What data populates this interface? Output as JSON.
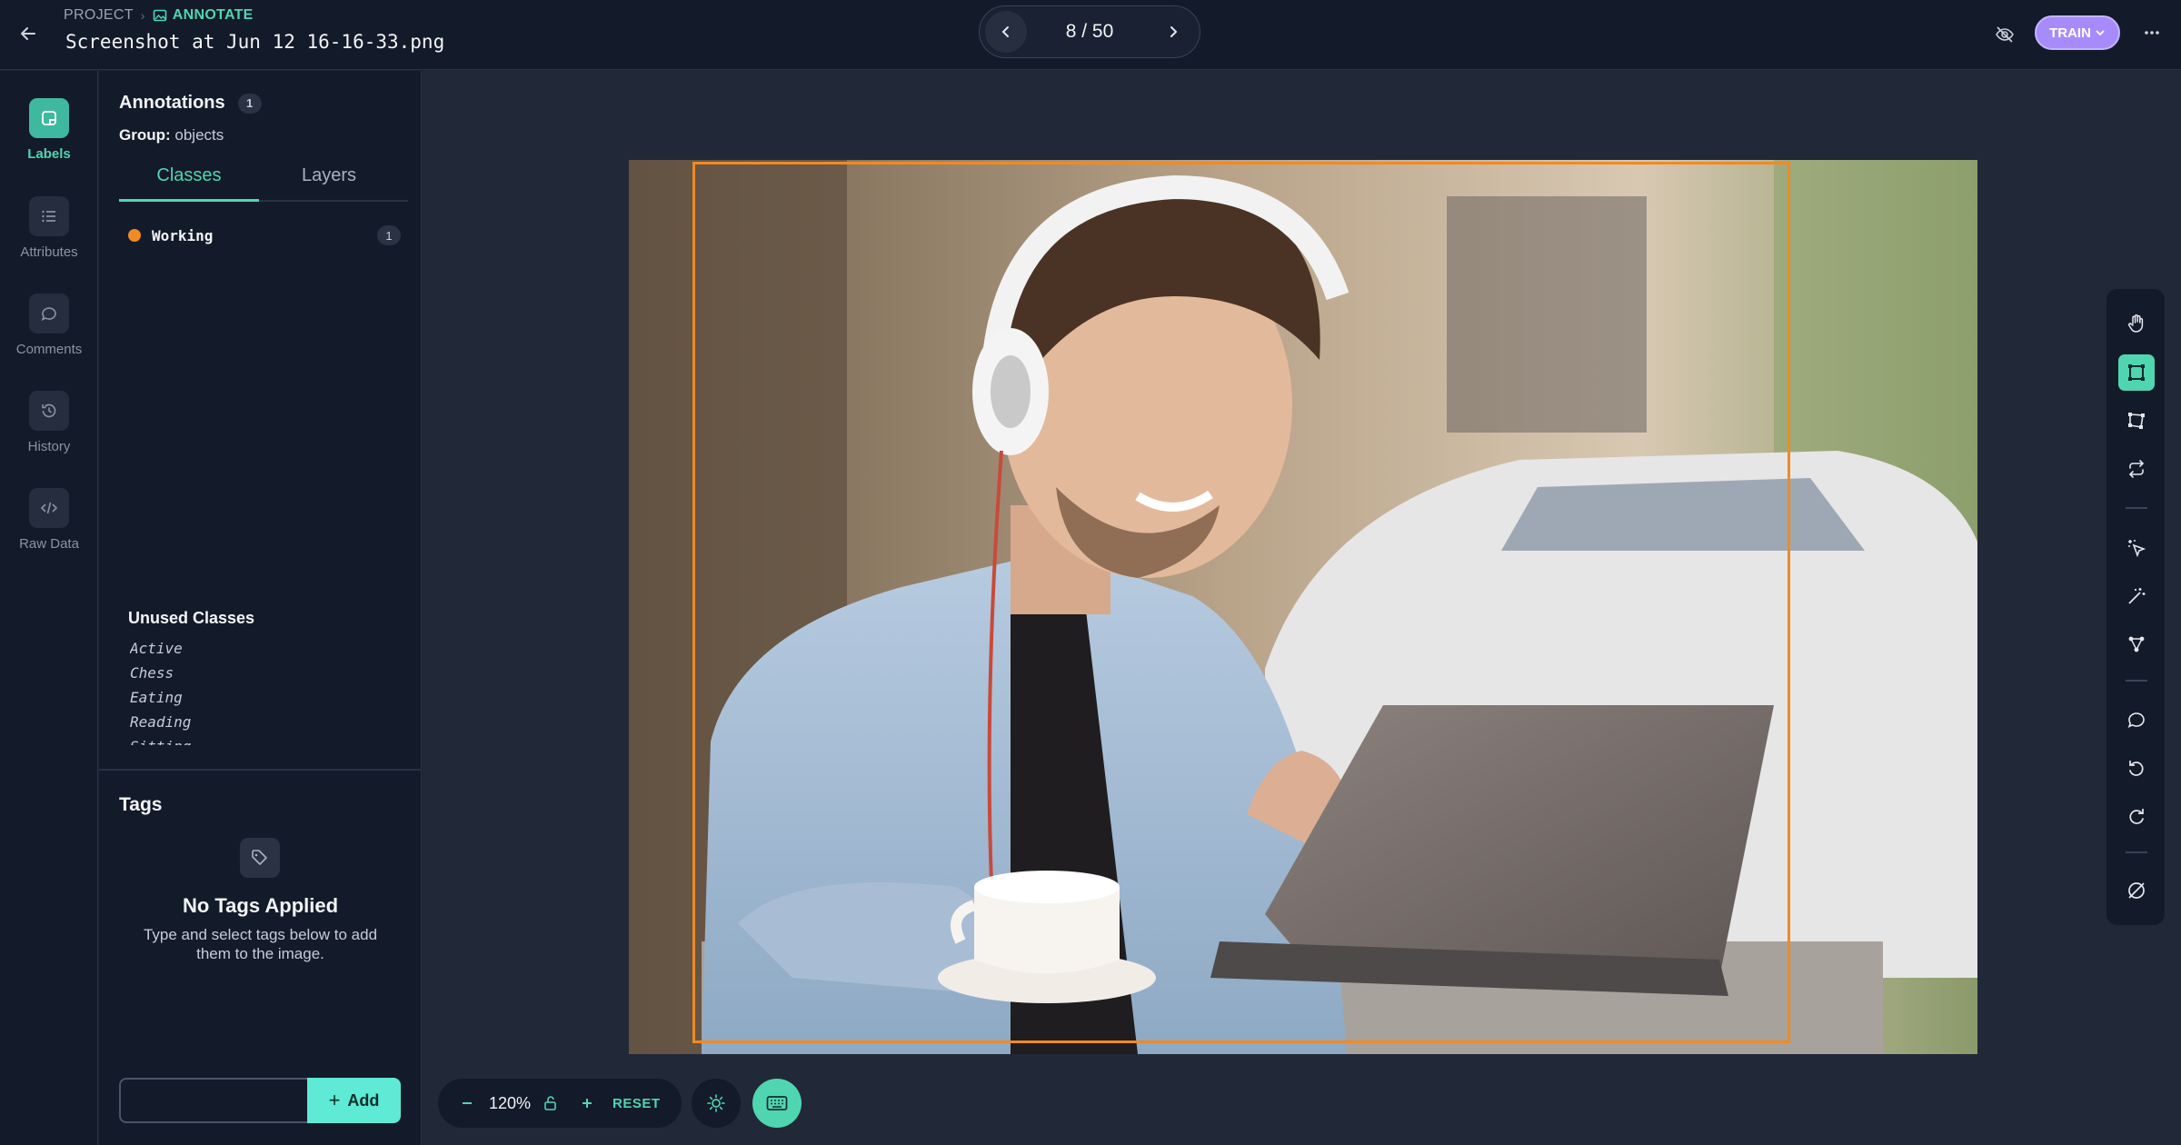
{
  "header": {
    "breadcrumb_project": "PROJECT",
    "breadcrumb_current": "ANNOTATE",
    "file_name": "Screenshot at Jun 12 16-16-33.png",
    "pager_text": "8 / 50",
    "train_label": "TRAIN"
  },
  "rail": {
    "items": [
      {
        "label": "Labels",
        "icon": "label-icon",
        "active": true
      },
      {
        "label": "Attributes",
        "icon": "list-icon"
      },
      {
        "label": "Comments",
        "icon": "comment-icon"
      },
      {
        "label": "History",
        "icon": "history-icon"
      },
      {
        "label": "Raw Data",
        "icon": "code-icon"
      }
    ]
  },
  "panel": {
    "title": "Annotations",
    "count": "1",
    "group_label": "Group:",
    "group_value": "objects",
    "tabs": [
      "Classes",
      "Layers"
    ],
    "active_tab": "Classes",
    "classes": [
      {
        "name": "Working",
        "count": "1",
        "color": "#f08a24"
      }
    ],
    "unused_title": "Unused Classes",
    "unused_classes": [
      "Active",
      "Chess",
      "Eating",
      "Reading",
      "Sitting"
    ]
  },
  "tags": {
    "title": "Tags",
    "empty_title": "No Tags Applied",
    "empty_subtitle": "Type and select tags below to add them to the image.",
    "input_value": "",
    "add_label": "Add"
  },
  "zoom": {
    "value": "120%",
    "reset_label": "RESET"
  },
  "colors": {
    "accent": "#4fd6b0",
    "train": "#a78bfa",
    "bbox": "#f08a24"
  },
  "toolbar": [
    "hand-icon",
    "bounding-box-icon",
    "polygon-icon",
    "repeat-icon",
    "smart-select-icon",
    "magic-wand-icon",
    "keypoint-icon",
    "comment-icon",
    "undo-icon",
    "redo-icon",
    "clear-icon"
  ]
}
